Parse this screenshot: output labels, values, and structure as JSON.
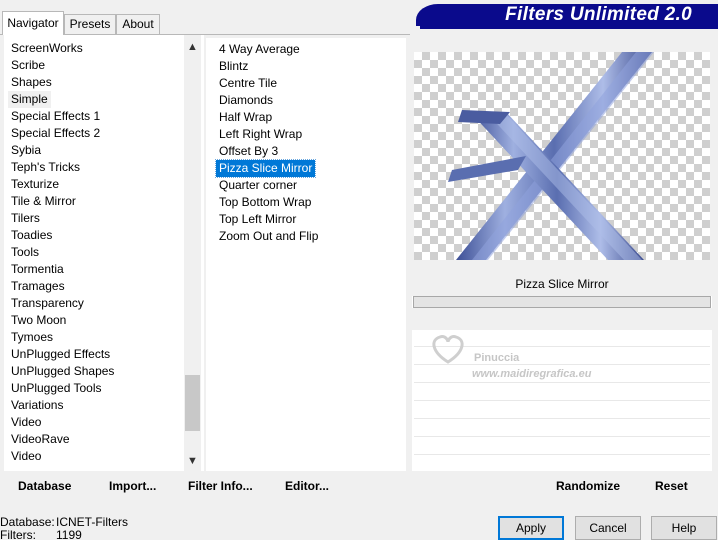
{
  "tabs": [
    "Navigator",
    "Presets",
    "About"
  ],
  "banner_title": "Filters Unlimited 2.0",
  "categories": [
    "ScreenWorks",
    "Scribe",
    "Shapes",
    "Simple",
    "Special Effects 1",
    "Special Effects 2",
    "Sybia",
    "Teph's Tricks",
    "Texturize",
    "Tile & Mirror",
    "Tilers",
    "Toadies",
    "Tools",
    "Tormentia",
    "Tramages",
    "Transparency",
    "Two Moon",
    "Tymoes",
    "UnPlugged Effects",
    "UnPlugged Shapes",
    "UnPlugged Tools",
    "Variations",
    "Video",
    "VideoRave",
    "Video"
  ],
  "selected_category": "Simple",
  "filters": [
    "4 Way Average",
    "Blintz",
    "Centre Tile",
    "Diamonds",
    "Half Wrap",
    "Left Right Wrap",
    "Offset By 3",
    "Pizza Slice Mirror",
    "Quarter corner",
    "Top Bottom Wrap",
    "Top Left Mirror",
    "Zoom Out and Flip"
  ],
  "selected_filter": "Pizza Slice Mirror",
  "preview_filter_name": "Pizza Slice Mirror",
  "watermark": {
    "name": "Pinuccia",
    "url": "www.maidiregrafica.eu"
  },
  "toolbar_left": {
    "database": "Database",
    "import": "Import...",
    "filter_info": "Filter Info...",
    "editor": "Editor..."
  },
  "toolbar_right": {
    "randomize": "Randomize",
    "reset": "Reset"
  },
  "status": {
    "database_label": "Database:",
    "database_value": "ICNET-Filters",
    "filters_label": "Filters:",
    "filters_value": "1199"
  },
  "buttons": {
    "apply": "Apply",
    "cancel": "Cancel",
    "help": "Help"
  },
  "icons": {
    "scroll_up": "chevron-up-icon",
    "scroll_down": "chevron-down-icon"
  },
  "colors": {
    "banner": "#0a0a8c",
    "selection": "#0078d7",
    "x_shape": "#5a6eb0"
  }
}
